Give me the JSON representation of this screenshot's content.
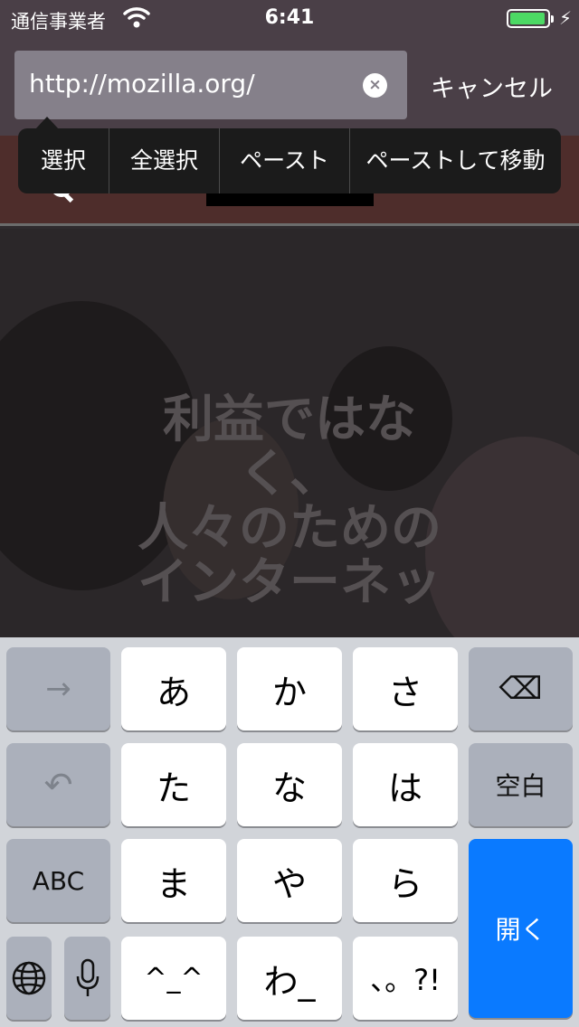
{
  "status_bar": {
    "carrier": "通信事業者",
    "time": "6:41",
    "battery_level": 0.95
  },
  "url_bar": {
    "value": "http://mozilla.org/",
    "clear_icon": "×",
    "cancel_label": "キャンセル"
  },
  "edit_menu": {
    "items": [
      "選択",
      "全選択",
      "ペースト",
      "ペーストして移動"
    ]
  },
  "webpage": {
    "heading_lines": [
      "利益ではな",
      "く、",
      "人々のための",
      "インターネッ"
    ]
  },
  "keyboard": {
    "row1": {
      "next": "→",
      "keys": [
        "あ",
        "か",
        "さ"
      ],
      "delete_icon": "⌫"
    },
    "row2": {
      "undo": "↶",
      "keys": [
        "た",
        "な",
        "は"
      ],
      "space": "空白"
    },
    "row3": {
      "abc": "ABC",
      "keys": [
        "ま",
        "や",
        "ら"
      ],
      "go": "開く"
    },
    "row4": {
      "globe_icon": "globe-icon",
      "mic_icon": "microphone-icon",
      "keys": [
        "^_^",
        "わ_",
        "、。?!"
      ]
    }
  },
  "colors": {
    "accent": "#0a7aff",
    "battery": "#4cd964",
    "chrome": "#4a3f47",
    "keyboard_bg": "#d1d4d9"
  }
}
